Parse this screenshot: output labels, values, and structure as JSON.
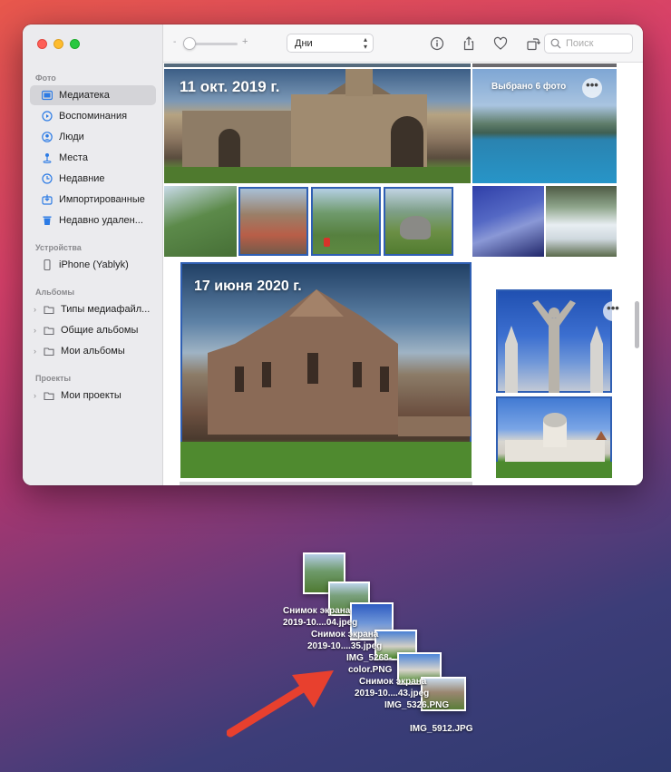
{
  "sidebar": {
    "section_photos": "Фото",
    "items": [
      {
        "label": "Медиатека",
        "icon": "library-icon"
      },
      {
        "label": "Воспоминания",
        "icon": "memories-icon"
      },
      {
        "label": "Люди",
        "icon": "people-icon"
      },
      {
        "label": "Места",
        "icon": "places-icon"
      },
      {
        "label": "Недавние",
        "icon": "recents-icon"
      },
      {
        "label": "Импортированные",
        "icon": "imported-icon"
      },
      {
        "label": "Недавно удален...",
        "icon": "trash-icon"
      }
    ],
    "section_devices": "Устройства",
    "device": "iPhone (Yablyk)",
    "section_albums": "Альбомы",
    "albums": [
      "Типы медиафайл...",
      "Общие альбомы",
      "Мои альбомы"
    ],
    "section_projects": "Проекты",
    "projects": [
      "Мои проекты"
    ]
  },
  "toolbar": {
    "zoom_minus": "-",
    "zoom_plus": "+",
    "view_select": "Дни",
    "search_placeholder": "Поиск"
  },
  "grid": {
    "date1": "11 окт. 2019 г.",
    "selected_count": "Выбрано 6 фото",
    "date2": "17 июня 2020 г.",
    "more": "•••"
  },
  "drag_files": [
    "Снимок экрана",
    "2019-10....04.jpeg",
    "Снимок экрана",
    "2019-10....35.jpeg",
    "IMG_5268-",
    "color.PNG",
    "Снимок экрана",
    "2019-10....43.jpeg",
    "IMG_5326.PNG",
    "IMG_5912.JPG"
  ],
  "colors": {
    "accent": "#2c7be5",
    "selection": "#2f5fb3",
    "arrow": "#e8402e"
  }
}
